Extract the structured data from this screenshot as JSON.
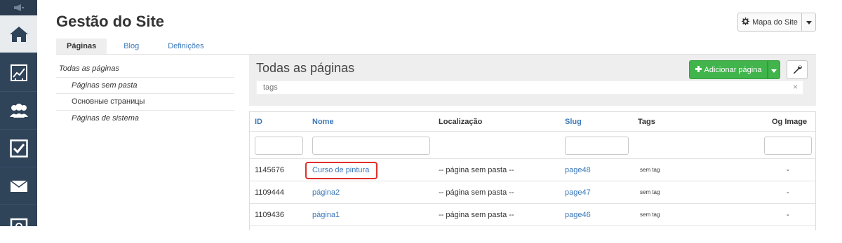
{
  "header": {
    "title": "Gestão do Site",
    "sitemap_label": "Mapa do Site"
  },
  "rail": {
    "icons": [
      "megaphone-icon",
      "home-icon",
      "chart-icon",
      "users-icon",
      "checkbox-icon",
      "envelope-icon",
      "settings-icon"
    ],
    "active": "home-icon"
  },
  "tabs": [
    {
      "label": "Páginas",
      "active": true
    },
    {
      "label": "Blog",
      "active": false
    },
    {
      "label": "Definições",
      "active": false
    }
  ],
  "folders": [
    {
      "label": "Todas as páginas"
    },
    {
      "label": "Páginas sem pasta"
    },
    {
      "label": "Основные страницы"
    },
    {
      "label": "Páginas de sistema"
    }
  ],
  "panel": {
    "title": "Todas as páginas",
    "add_label": "Adicionar página",
    "tags_placeholder": "tags",
    "clear_symbol": "×"
  },
  "table": {
    "columns": [
      "ID",
      "Nome",
      "Localização",
      "Slug",
      "Tags",
      "Og Image"
    ],
    "rows": [
      {
        "id": "1145676",
        "name": "Curso de pintura",
        "location": "-- página sem pasta --",
        "slug": "page48",
        "tags": "sem tag",
        "og": "-",
        "highlighted": true
      },
      {
        "id": "1109444",
        "name": "página2",
        "location": "-- página sem pasta --",
        "slug": "page47",
        "tags": "sem tag",
        "og": "-"
      },
      {
        "id": "1109436",
        "name": "página1",
        "location": "-- página sem pasta --",
        "slug": "page46",
        "tags": "sem tag",
        "og": "-"
      }
    ]
  },
  "colors": {
    "rail": "#2f4359",
    "accent_green": "#41b44c",
    "link_blue": "#3b78b8",
    "highlight_red": "#e0302a"
  }
}
